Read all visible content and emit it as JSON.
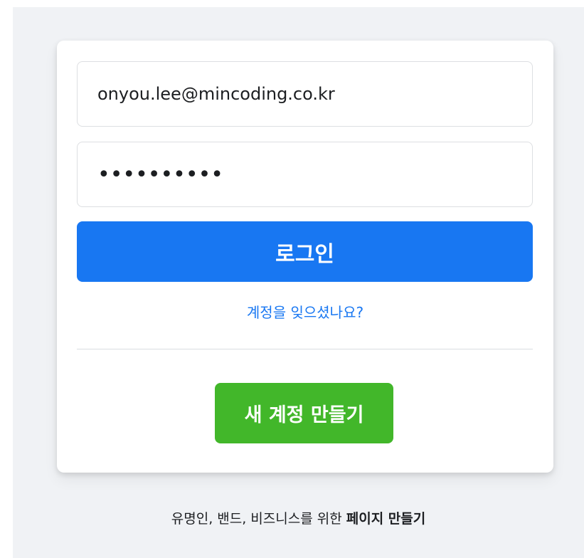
{
  "login": {
    "email_value": "onyou.lee@mincoding.co.kr",
    "password_masked": "••••••••••",
    "login_label": "로그인",
    "forgot_label": "계정을 잊으셨나요?",
    "create_label": "새 계정 만들기"
  },
  "footer": {
    "prefix": "유명인, 밴드, 비즈니스를 위한 ",
    "link": "페이지 만들기"
  },
  "colors": {
    "background": "#f0f2f5",
    "primary": "#1877f2",
    "success": "#42b72a"
  }
}
